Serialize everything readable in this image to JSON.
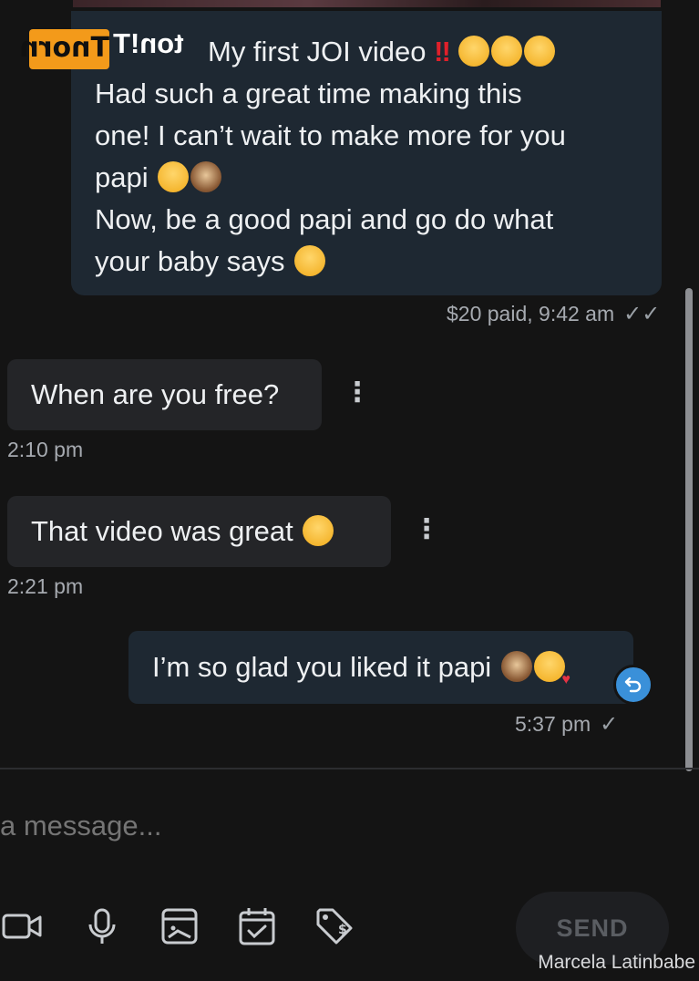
{
  "paid_message": {
    "title": "My first JOI video",
    "lines": [
      "Had such a great time making this",
      "one! I can’t wait to make more for you",
      "papi",
      "Now, be a good papi and go do what",
      "your baby says"
    ],
    "meta": "$20 paid, 9:42 am"
  },
  "brand_logo": {
    "text": "Tnorn",
    "tail": "ton!T"
  },
  "messages": [
    {
      "text": "When are you free?",
      "time": "2:10 pm"
    },
    {
      "text": "That video was great",
      "time": "2:21 pm"
    },
    {
      "text": "I’m so glad you liked it papi",
      "time": "5:37 pm"
    }
  ],
  "composer": {
    "placeholder": "a message...",
    "send_label": "SEND"
  },
  "watermark": "Marcela Latinbabe",
  "colors": {
    "background": "#141414",
    "outgoing_bubble": "#1e2832",
    "incoming_bubble": "#242528",
    "accent": "#3a90d9",
    "logo": "#f39a1a"
  },
  "icons": [
    "video-icon",
    "microphone-icon",
    "image-icon",
    "calendar-check-icon",
    "price-tag-icon"
  ]
}
